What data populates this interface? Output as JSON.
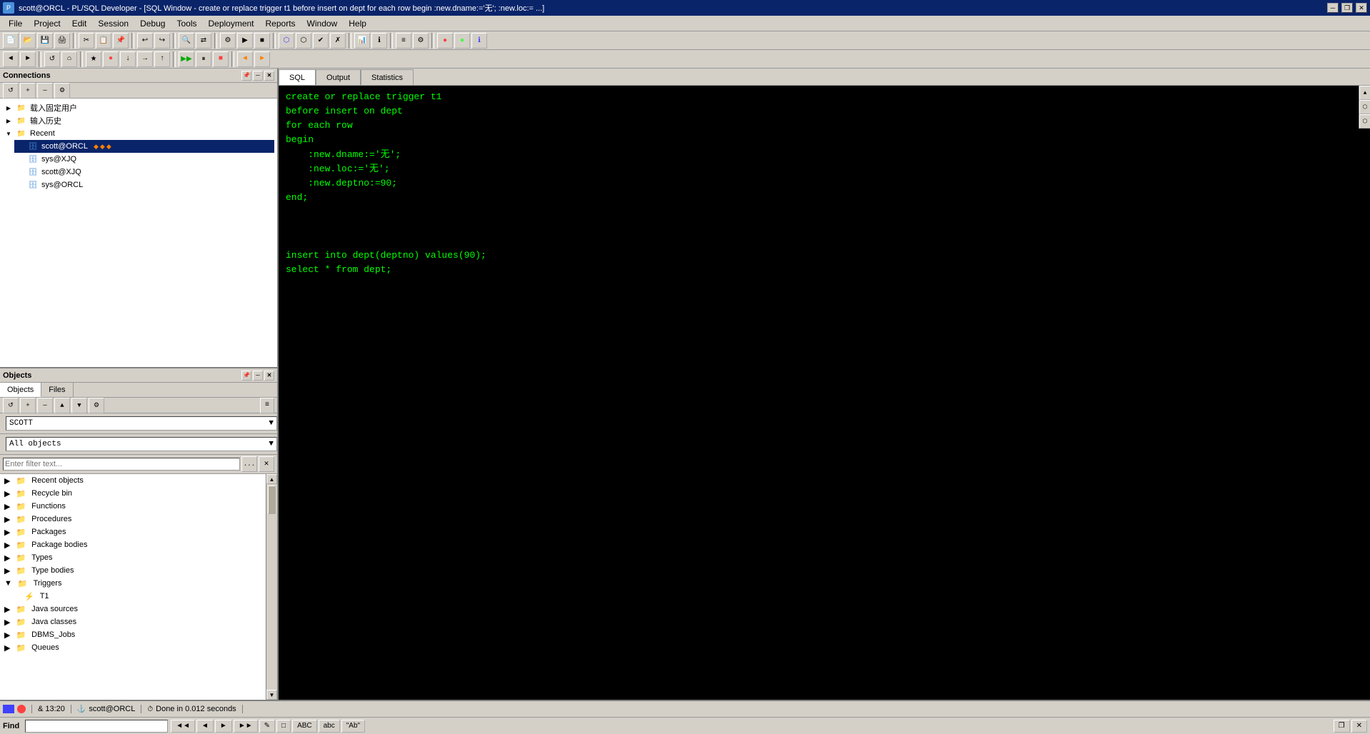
{
  "title_bar": {
    "title": "scott@ORCL - PL/SQL Developer - [SQL Window - create or replace trigger t1 before insert on dept for each row begin :new.dname:='无'; :new.loc:= ...]",
    "app_name": "scott@ORCL - PL/SQL Developer",
    "window_title": "[SQL Window - create or replace trigger t1 before insert on dept for each row begin :new.dname:='无'; :new.loc:= ...]",
    "minimize": "─",
    "maximize": "□",
    "close": "✕",
    "restore": "❐"
  },
  "menu": {
    "items": [
      "File",
      "Project",
      "Edit",
      "Session",
      "Debug",
      "Tools",
      "Deployment",
      "Reports",
      "Window",
      "Help"
    ]
  },
  "connections_panel": {
    "title": "Connections",
    "tree": [
      {
        "level": 0,
        "label": "载入固定用户",
        "icon": "folder",
        "expanded": false
      },
      {
        "level": 0,
        "label": "输入历史",
        "icon": "folder",
        "expanded": false
      },
      {
        "level": 0,
        "label": "Recent",
        "icon": "folder",
        "expanded": true
      },
      {
        "level": 1,
        "label": "scott@ORCL",
        "icon": "db",
        "expanded": false,
        "selected": true
      },
      {
        "level": 1,
        "label": "sys@XJQ",
        "icon": "db",
        "expanded": false
      },
      {
        "level": 1,
        "label": "scott@XJQ",
        "icon": "db",
        "expanded": false
      },
      {
        "level": 1,
        "label": "sys@ORCL",
        "icon": "db",
        "expanded": false
      }
    ]
  },
  "objects_panel": {
    "title": "Objects",
    "tabs": [
      "Objects",
      "Files"
    ],
    "active_tab": "Objects",
    "schema": "SCOTT",
    "object_type": "All objects",
    "filter_placeholder": "Enter filter text...",
    "tree": [
      {
        "level": 0,
        "label": "Recent objects",
        "icon": "folder",
        "expanded": false
      },
      {
        "level": 0,
        "label": "Recycle bin",
        "icon": "folder",
        "expanded": false
      },
      {
        "level": 0,
        "label": "Functions",
        "icon": "folder",
        "expanded": false
      },
      {
        "level": 0,
        "label": "Procedures",
        "icon": "folder",
        "expanded": false
      },
      {
        "level": 0,
        "label": "Packages",
        "icon": "folder",
        "expanded": false
      },
      {
        "level": 0,
        "label": "Package bodies",
        "icon": "folder",
        "expanded": false
      },
      {
        "level": 0,
        "label": "Types",
        "icon": "folder",
        "expanded": false
      },
      {
        "level": 0,
        "label": "Type bodies",
        "icon": "folder",
        "expanded": false
      },
      {
        "level": 0,
        "label": "Triggers",
        "icon": "folder",
        "expanded": true
      },
      {
        "level": 1,
        "label": "T1",
        "icon": "trigger",
        "expanded": false
      },
      {
        "level": 0,
        "label": "Java sources",
        "icon": "folder",
        "expanded": false
      },
      {
        "level": 0,
        "label": "Java classes",
        "icon": "folder",
        "expanded": false
      },
      {
        "level": 0,
        "label": "DBMS_Jobs",
        "icon": "folder",
        "expanded": false
      },
      {
        "level": 0,
        "label": "Queues",
        "icon": "folder",
        "expanded": false
      }
    ]
  },
  "sql_editor": {
    "tabs": [
      "SQL",
      "Output",
      "Statistics"
    ],
    "active_tab": "SQL",
    "code": "create or replace trigger t1\nbefore insert on dept\nfor each row\nbegin\n    :new.dname:='无';\n    :new.loc:='无';\n    :new.deptno:=90;\nend;\n\n\n\ninsert into dept(deptno) values(90);\nselect * from dept;"
  },
  "status_bar": {
    "line": "& 13:20",
    "connection": "scott@ORCL",
    "status": "Done in 0.012 seconds"
  },
  "find_bar": {
    "label": "Find",
    "placeholder": "",
    "buttons": [
      "◄◄",
      "◄",
      "►",
      "►►",
      "✎",
      "□",
      "ABC",
      "abc",
      "\"Ab\""
    ]
  }
}
